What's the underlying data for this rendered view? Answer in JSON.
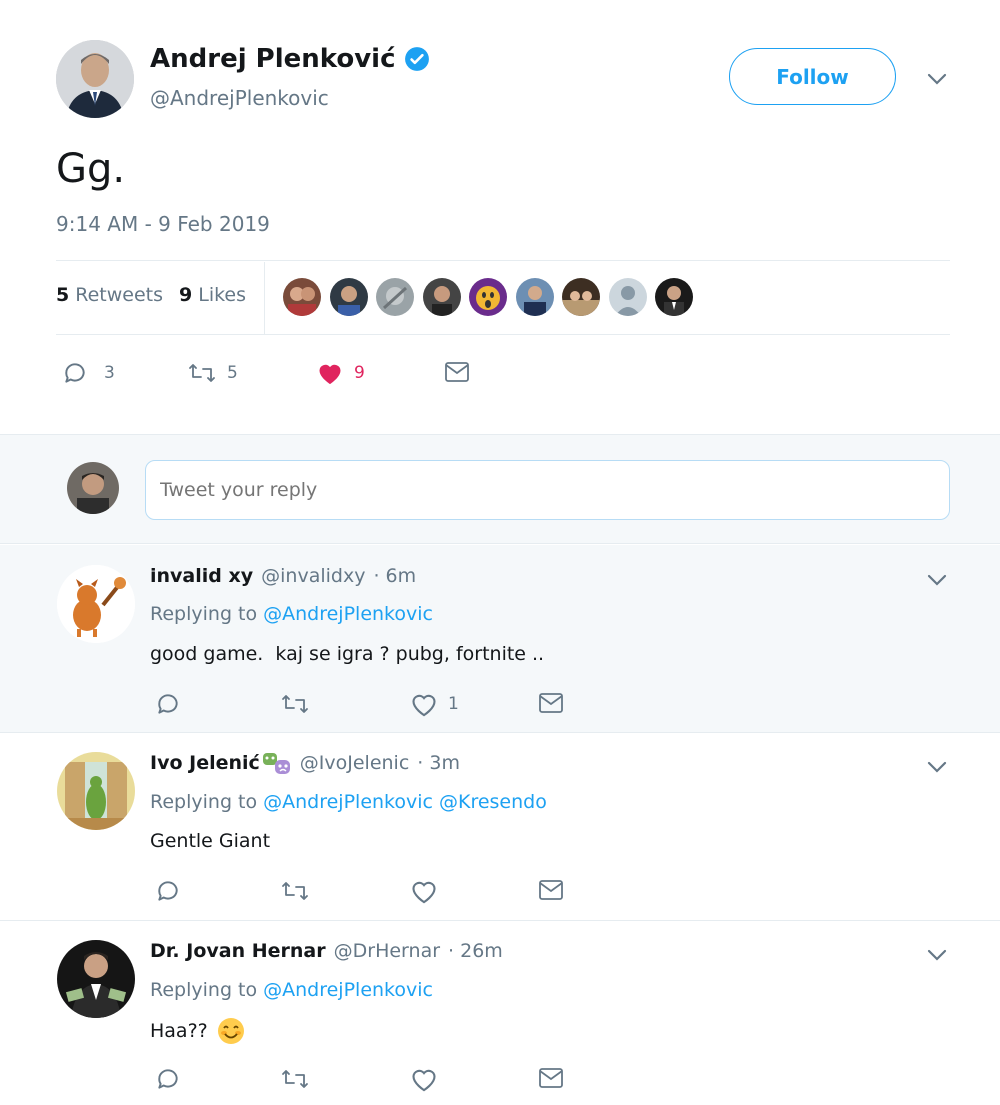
{
  "tweet": {
    "author_name": "Andrej Plenković",
    "author_handle": "@AndrejPlenkovic",
    "follow_label": "Follow",
    "text": "Gg.",
    "timestamp": "9:14 AM - 9 Feb 2019",
    "retweets_count": "5",
    "retweets_label": "Retweets",
    "likes_count": "9",
    "likes_label": "Likes",
    "actions": {
      "replies": "3",
      "retweets": "5",
      "likes": "9"
    },
    "liked": true
  },
  "reply_box": {
    "placeholder": "Tweet your reply"
  },
  "replies": [
    {
      "name": "invalid xy",
      "handle": "@invalidxy",
      "time": "· 6m",
      "replying_prefix": "Replying to",
      "replying_to": [
        "@AndrejPlenkovic"
      ],
      "text": "good game.  kaj se igra ? pubg, fortnite ..",
      "likes": "1"
    },
    {
      "name": "Ivo Jelenić",
      "handle": "@IvoJelenic",
      "time": "· 3m",
      "replying_prefix": "Replying to",
      "replying_to": [
        "@AndrejPlenkovic",
        "@Kresendo"
      ],
      "text": "Gentle Giant",
      "likes": ""
    },
    {
      "name": "Dr. Jovan Hernar",
      "handle": "@DrHernar",
      "time": "· 26m",
      "replying_prefix": "Replying to",
      "replying_to": [
        "@AndrejPlenkovic"
      ],
      "text": "Haa??",
      "likes": ""
    }
  ],
  "colors": {
    "accent": "#1da1f2",
    "like": "#e0245e",
    "muted": "#657786",
    "reply_bg": "#f5f8fa"
  }
}
